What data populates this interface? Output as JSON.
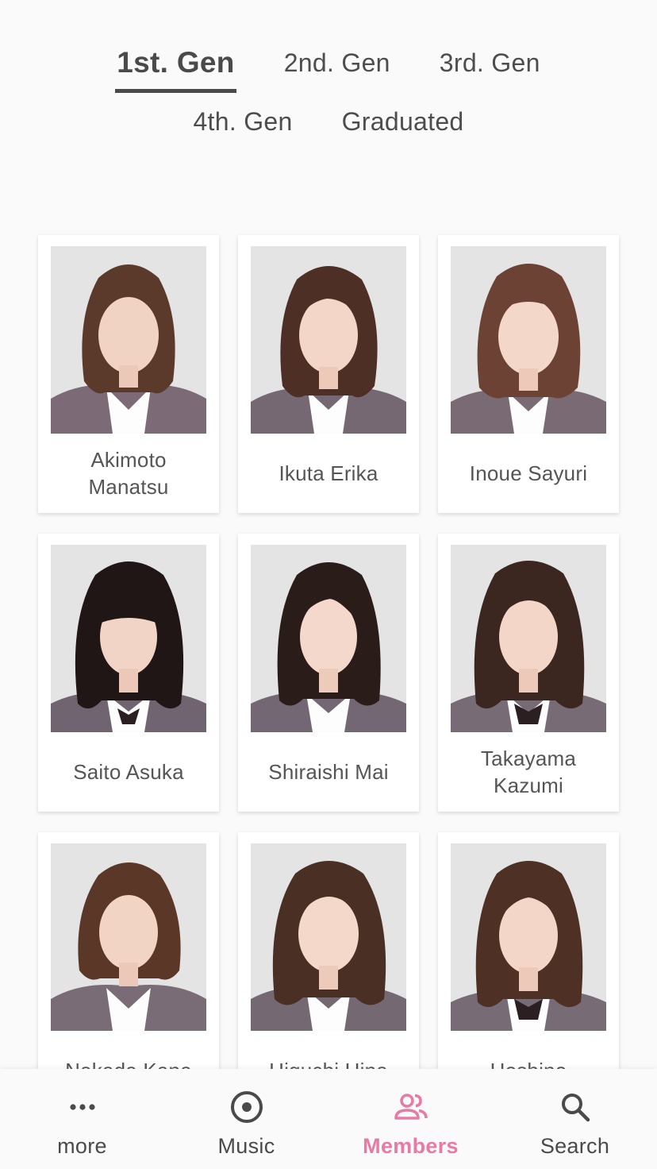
{
  "tabs": {
    "items": [
      {
        "label": "1st. Gen",
        "active": true
      },
      {
        "label": "2nd. Gen",
        "active": false
      },
      {
        "label": "3rd. Gen",
        "active": false
      },
      {
        "label": "4th. Gen",
        "active": false
      },
      {
        "label": "Graduated",
        "active": false
      }
    ]
  },
  "members": [
    {
      "name": "Akimoto Manatsu"
    },
    {
      "name": "Ikuta Erika"
    },
    {
      "name": "Inoue Sayuri"
    },
    {
      "name": "Saito Asuka"
    },
    {
      "name": "Shiraishi Mai"
    },
    {
      "name": "Takayama Kazumi"
    },
    {
      "name": "Nakada Kana"
    },
    {
      "name": "Higuchi Hina"
    },
    {
      "name": "Hoshino"
    }
  ],
  "nav": {
    "items": [
      {
        "label": "more",
        "icon": "more-dots-icon",
        "active": false
      },
      {
        "label": "Music",
        "icon": "music-disc-icon",
        "active": false
      },
      {
        "label": "Members",
        "icon": "members-icon",
        "active": true
      },
      {
        "label": "Search",
        "icon": "search-icon",
        "active": false
      }
    ],
    "active_color": "#e87aa6",
    "inactive_color": "#4a4a4a"
  }
}
